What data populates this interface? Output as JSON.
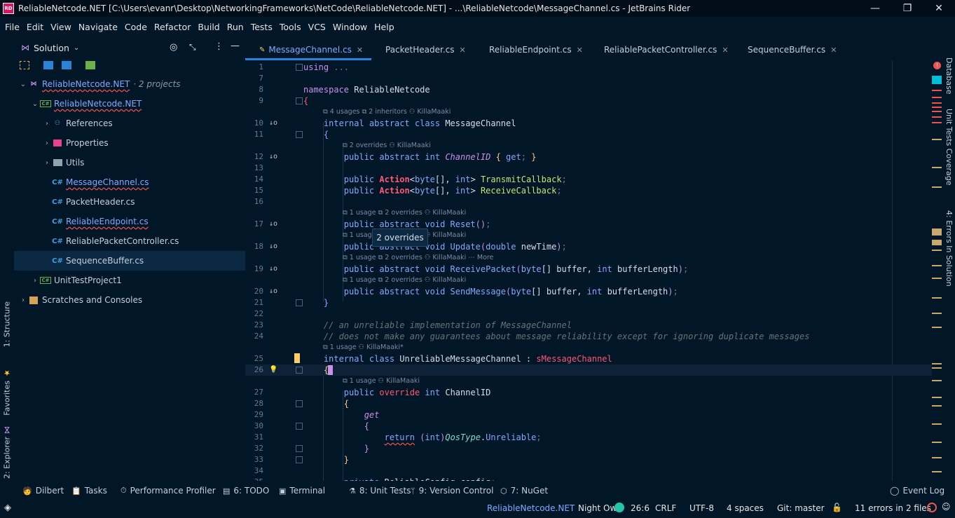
{
  "window": {
    "title": "ReliableNetcode.NET [C:\\Users\\evanr\\Desktop\\NetworkingFrameworks\\NetCode\\ReliableNetcode.NET] - ...\\ReliableNetcode\\MessageChannel.cs - JetBrains Rider",
    "logo_text": "RD"
  },
  "menu": [
    "File",
    "Edit",
    "View",
    "Navigate",
    "Code",
    "Refactor",
    "Build",
    "Run",
    "Tests",
    "Tools",
    "VCS",
    "Window",
    "Help"
  ],
  "left_vtabs": [
    "1: Structure",
    "Favorites",
    "2: Explorer"
  ],
  "explorer": {
    "title": "Solution",
    "tree": [
      {
        "label": "ReliableNetcode.NET",
        "extra": "· 2 projects",
        "depth": 0,
        "arrow": "⌄",
        "icon": "vs"
      },
      {
        "label": "ReliableNetcode.NET",
        "extra": "",
        "depth": 1,
        "arrow": "⌄",
        "icon": "proj"
      },
      {
        "label": "References",
        "extra": "",
        "depth": 2,
        "arrow": "›",
        "icon": "ref"
      },
      {
        "label": "Properties",
        "extra": "",
        "depth": 2,
        "arrow": "›",
        "icon": "props"
      },
      {
        "label": "Utils",
        "extra": "",
        "depth": 2,
        "arrow": "›",
        "icon": "folder"
      },
      {
        "label": "MessageChannel.cs",
        "extra": "",
        "depth": 2,
        "arrow": "",
        "icon": "cs",
        "error": true
      },
      {
        "label": "PacketHeader.cs",
        "extra": "",
        "depth": 2,
        "arrow": "",
        "icon": "cs"
      },
      {
        "label": "ReliableEndpoint.cs",
        "extra": "",
        "depth": 2,
        "arrow": "",
        "icon": "cs",
        "error": true
      },
      {
        "label": "ReliablePacketController.cs",
        "extra": "",
        "depth": 2,
        "arrow": "",
        "icon": "cs"
      },
      {
        "label": "SequenceBuffer.cs",
        "extra": "",
        "depth": 2,
        "arrow": "",
        "icon": "cs",
        "selected": true
      },
      {
        "label": "UnitTestProject1",
        "extra": "",
        "depth": 1,
        "arrow": "›",
        "icon": "proj"
      },
      {
        "label": "Scratches and Consoles",
        "extra": "",
        "depth": 0,
        "arrow": "›",
        "icon": "scratch"
      }
    ]
  },
  "tabs": [
    {
      "label": "MessageChannel.cs",
      "active": true
    },
    {
      "label": "PacketHeader.cs",
      "active": false
    },
    {
      "label": "ReliableEndpoint.cs",
      "active": false
    },
    {
      "label": "ReliablePacketController.cs",
      "active": false
    },
    {
      "label": "SequenceBuffer.cs",
      "active": false
    }
  ],
  "hints": [
    {
      "before_line": "10",
      "indent": 1,
      "text": "⧉ 4 usages  ⧉ 2 inheritors  ⚇ KillaMaaki"
    },
    {
      "before_line": "12",
      "indent": 2,
      "text": "⧉ 2 overrides  ⚇ KillaMaaki"
    },
    {
      "before_line": "17",
      "indent": 2,
      "text": "⧉ 1 usage  ⧉ 2 overrides  ⚇ KillaMaaki"
    },
    {
      "before_line": "18",
      "indent": 2,
      "text": "⧉ 1 usage  ⧉ 2 overrides  ⚇ KillaMaaki"
    },
    {
      "before_line": "19",
      "indent": 2,
      "text": "⧉ 1 usage  ⧉ 2 overrides  ⚇ KillaMaaki  ⋯ More"
    },
    {
      "before_line": "20",
      "indent": 2,
      "text": "⧉ 1 usage  ⧉ 2 overrides  ⚇ KillaMaaki"
    },
    {
      "before_line": "25",
      "indent": 1,
      "text": "⧉ 1 usage  ⚇ KillaMaaki*"
    },
    {
      "before_line": "27",
      "indent": 2,
      "text": "⧉ 1 usage  ⚇ KillaMaaki"
    }
  ],
  "tooltip": "2 overrides",
  "code_lines": [
    {
      "n": "1",
      "gutter": "",
      "html": "<span class='kp'>using</span> <span class='dim'>...</span>"
    },
    {
      "n": "7",
      "gutter": "",
      "html": ""
    },
    {
      "n": "8",
      "gutter": "",
      "html": "<span class='kp'>namespace</span> <span class='id'>ReliableNetcode</span>"
    },
    {
      "n": "9",
      "gutter": "",
      "html": "<span class='red' style='font-weight:normal'>{</span>"
    },
    {
      "n": "10",
      "gutter": "↓o",
      "html": "    <span class='k'>internal abstract class</span> <span class='id'>MessageChannel</span>"
    },
    {
      "n": "11",
      "gutter": "",
      "html": "    <span class='fn'>{</span>"
    },
    {
      "n": "12",
      "gutter": "↓o",
      "html": "        <span class='k'>public abstract int</span> <span class='kw'>ChannelID</span> <span class='t'>{</span> <span class='k'>get</span><span class='dim'>;</span> <span class='t'>}</span>"
    },
    {
      "n": "13",
      "gutter": "",
      "html": ""
    },
    {
      "n": "14",
      "gutter": "",
      "html": "        <span class='k'>public</span> <span class='red'>Action</span><span class='pun'>&lt;</span><span class='k'>byte</span><span class='pun'>[], </span><span class='k'>int</span><span class='pun'>&gt;</span> <span class='t2'>TransmitCallback</span><span class='dim'>;</span>"
    },
    {
      "n": "15",
      "gutter": "",
      "html": "        <span class='k'>public</span> <span class='red'>Action</span><span class='pun'>&lt;</span><span class='k'>byte</span><span class='pun'>[], </span><span class='k'>int</span><span class='pun'>&gt;</span> <span class='t2'>ReceiveCallback</span><span class='dim'>;</span>"
    },
    {
      "n": "16",
      "gutter": "",
      "html": ""
    },
    {
      "n": "17",
      "gutter": "↓o",
      "html": "        <span class='k'>public abstract void</span> <span class='fn'>Reset</span><span class='kp'>()</span><span class='dim'>;</span>"
    },
    {
      "n": "18",
      "gutter": "↓o",
      "html": "        <span class='k'>public abstract void</span> <span class='fn'>Update</span><span class='kp'>(</span><span class='k'>double</span> <span class='id'>newTime</span><span class='kp'>)</span><span class='dim'>;</span>"
    },
    {
      "n": "19",
      "gutter": "↓o",
      "html": "        <span class='k'>public abstract void</span> <span class='fn'>ReceivePacket</span><span class='kp'>(</span><span class='k'>byte</span><span class='pun'>[] </span><span class='id'>buffer</span><span class='pun'>, </span><span class='k'>int</span> <span class='id'>bufferLength</span><span class='kp'>)</span><span class='dim'>;</span>"
    },
    {
      "n": "20",
      "gutter": "↓o",
      "html": "        <span class='k'>public abstract void</span> <span class='fn'>SendMessage</span><span class='kp'>(</span><span class='k'>byte</span><span class='pun'>[] </span><span class='id'>buffer</span><span class='pun'>, </span><span class='k'>int</span> <span class='id'>bufferLength</span><span class='kp'>)</span><span class='dim'>;</span>"
    },
    {
      "n": "21",
      "gutter": "",
      "html": "    <span class='fn'>}</span>"
    },
    {
      "n": "22",
      "gutter": "",
      "html": ""
    },
    {
      "n": "23",
      "gutter": "",
      "html": "    <span class='cm'>// an unreliable implementation of MessageChannel</span>"
    },
    {
      "n": "24",
      "gutter": "",
      "html": "    <span class='cm'>// does not make any guarantees about message reliability except for ignoring duplicate messages</span>"
    },
    {
      "n": "25",
      "gutter": "",
      "html": "    <span class='k'>internal class</span> <span class='id'>UnreliableMessageChannel</span> <span class='pun'>:</span> <span class='red' style='font-weight:normal'>sMessageChannel</span>"
    },
    {
      "n": "26",
      "gutter": "💡",
      "html": "    <span class='t'>{</span>",
      "current": true
    },
    {
      "n": "27",
      "gutter": "",
      "html": "        <span class='k'>public</span> <span class='red' style='font-weight:normal;color:#ff5874'>override</span> <span class='k'>int</span> <span class='id'>ChannelID</span>"
    },
    {
      "n": "28",
      "gutter": "",
      "html": "        <span class='t'>{</span>"
    },
    {
      "n": "29",
      "gutter": "",
      "html": "            <span class='kw'>get</span>"
    },
    {
      "n": "30",
      "gutter": "",
      "html": "            <span class='kp'>{</span>"
    },
    {
      "n": "31",
      "gutter": "",
      "html": "                <span class='k wavy'>return</span> <span class='kp'>(</span><span class='k'>int</span><span class='kp'>)</span><span class='it'>QosType</span><span class='pun'>.</span><span class='fn'>Unreliable</span><span class='dim'>;</span>"
    },
    {
      "n": "32",
      "gutter": "",
      "html": "            <span class='kp'>}</span>"
    },
    {
      "n": "33",
      "gutter": "",
      "html": "        <span class='t'>}</span>"
    },
    {
      "n": "34",
      "gutter": "",
      "html": ""
    },
    {
      "n": "35",
      "gutter": "",
      "html": "        <span class='k'>private</span> <span class='id'>ReliableConfig</span> <span class='id'>config</span><span class='dim'>;</span>"
    }
  ],
  "right_vtabs": [
    "Database",
    "Unit Tests Coverage",
    "4: Errors In Solution"
  ],
  "toolwindows": [
    {
      "icon": "🧑",
      "label": "Dilbert"
    },
    {
      "icon": "📋",
      "label": "Tasks"
    },
    {
      "icon": "⏱",
      "label": "Performance Profiler"
    },
    {
      "icon": "▤",
      "label": "6: TODO"
    },
    {
      "icon": "▣",
      "label": "Terminal"
    },
    {
      "icon": "⚗",
      "label": "8: Unit Tests"
    },
    {
      "icon": "ᛘ",
      "label": "9: Version Control"
    },
    {
      "icon": "⬡",
      "label": "7: NuGet"
    }
  ],
  "event_log": "Event Log",
  "status": {
    "project": "ReliableNetcode.NET",
    "theme": "Night Owl",
    "position": "26:6",
    "line_sep": "CRLF",
    "encoding": "UTF-8",
    "indent": "4 spaces",
    "git": "Git: master",
    "errors": "11 errors in 2 files"
  },
  "colors": {
    "bg": "#011627",
    "accent": "#2b82d6",
    "error": "#ef5350",
    "warning": "#c9a96e"
  }
}
